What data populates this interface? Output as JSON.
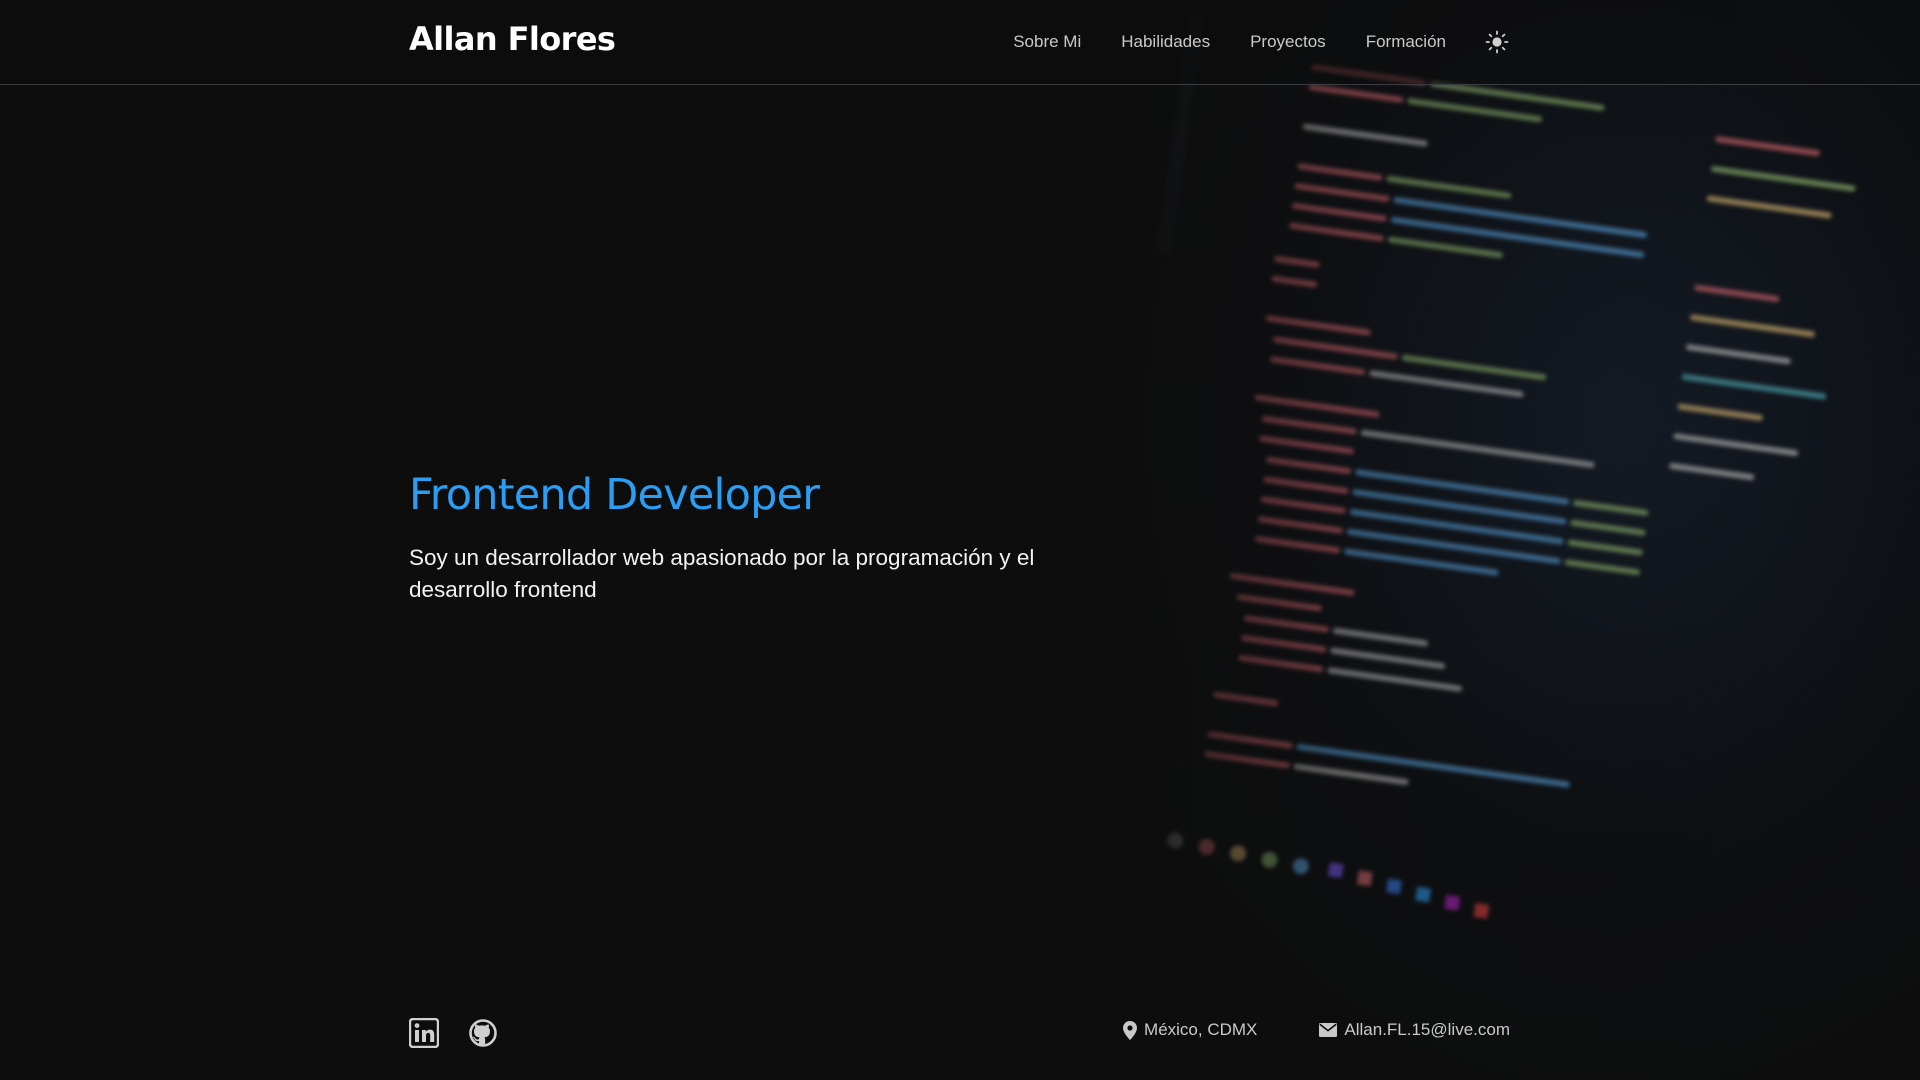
{
  "header": {
    "brand": "Allan Flores",
    "nav": [
      {
        "label": "Sobre Mi"
      },
      {
        "label": "Habilidades"
      },
      {
        "label": "Proyectos"
      },
      {
        "label": "Formación"
      }
    ],
    "theme_icon": "sun-icon"
  },
  "hero": {
    "title": "Frontend Developer",
    "description": "Soy un desarrollador web apasionado por la programación y el desarrollo frontend"
  },
  "footer": {
    "social": [
      {
        "icon": "linkedin-icon"
      },
      {
        "icon": "github-icon"
      }
    ],
    "location": "México, CDMX",
    "email": "Allan.FL.15@live.com",
    "location_icon": "map-pin-icon",
    "email_icon": "envelope-icon"
  },
  "colors": {
    "background": "#0d0d0d",
    "accent": "#2a9df4",
    "nav_text": "#c9c9c9",
    "body_text": "#f2f2f2",
    "divider": "#3a3d42"
  }
}
